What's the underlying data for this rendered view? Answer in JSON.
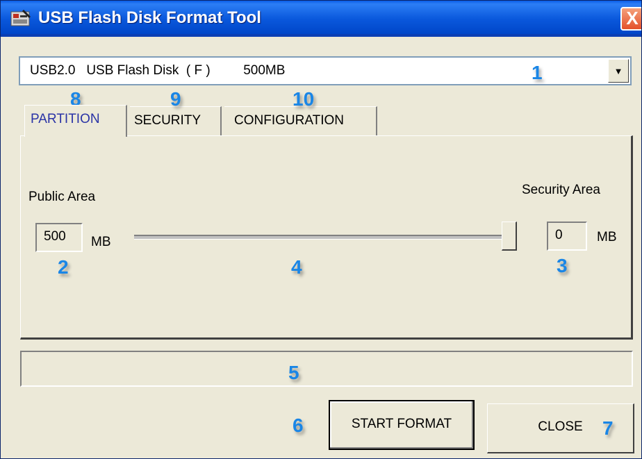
{
  "window": {
    "title": "USB Flash Disk Format Tool",
    "close_glyph": "X"
  },
  "drive_select": {
    "value": "USB2.0   USB Flash Disk  ( F )         500MB",
    "arrow": "▼"
  },
  "tabs": [
    {
      "label": "PARTITION",
      "active": true
    },
    {
      "label": "SECURITY",
      "active": false
    },
    {
      "label": "CONFIGURATION",
      "active": false
    }
  ],
  "partition": {
    "public_label": "Public Area",
    "public_value": "500",
    "security_label": "Security Area",
    "security_value": "0",
    "unit": "MB",
    "slider_fraction": 1.0
  },
  "buttons": {
    "start_format": "START FORMAT",
    "close": "CLOSE"
  },
  "callouts": [
    "1",
    "2",
    "3",
    "4",
    "5",
    "6",
    "7",
    "8",
    "9",
    "10"
  ],
  "colors": {
    "title_bar": "#0a58dc",
    "active_tab_text": "#2a33a6",
    "callout": "#1a86e6",
    "window_bg": "#ece9d8"
  },
  "icons": {
    "app": "usb-tool-icon",
    "close": "close-icon",
    "dropdown": "chevron-down-icon"
  }
}
